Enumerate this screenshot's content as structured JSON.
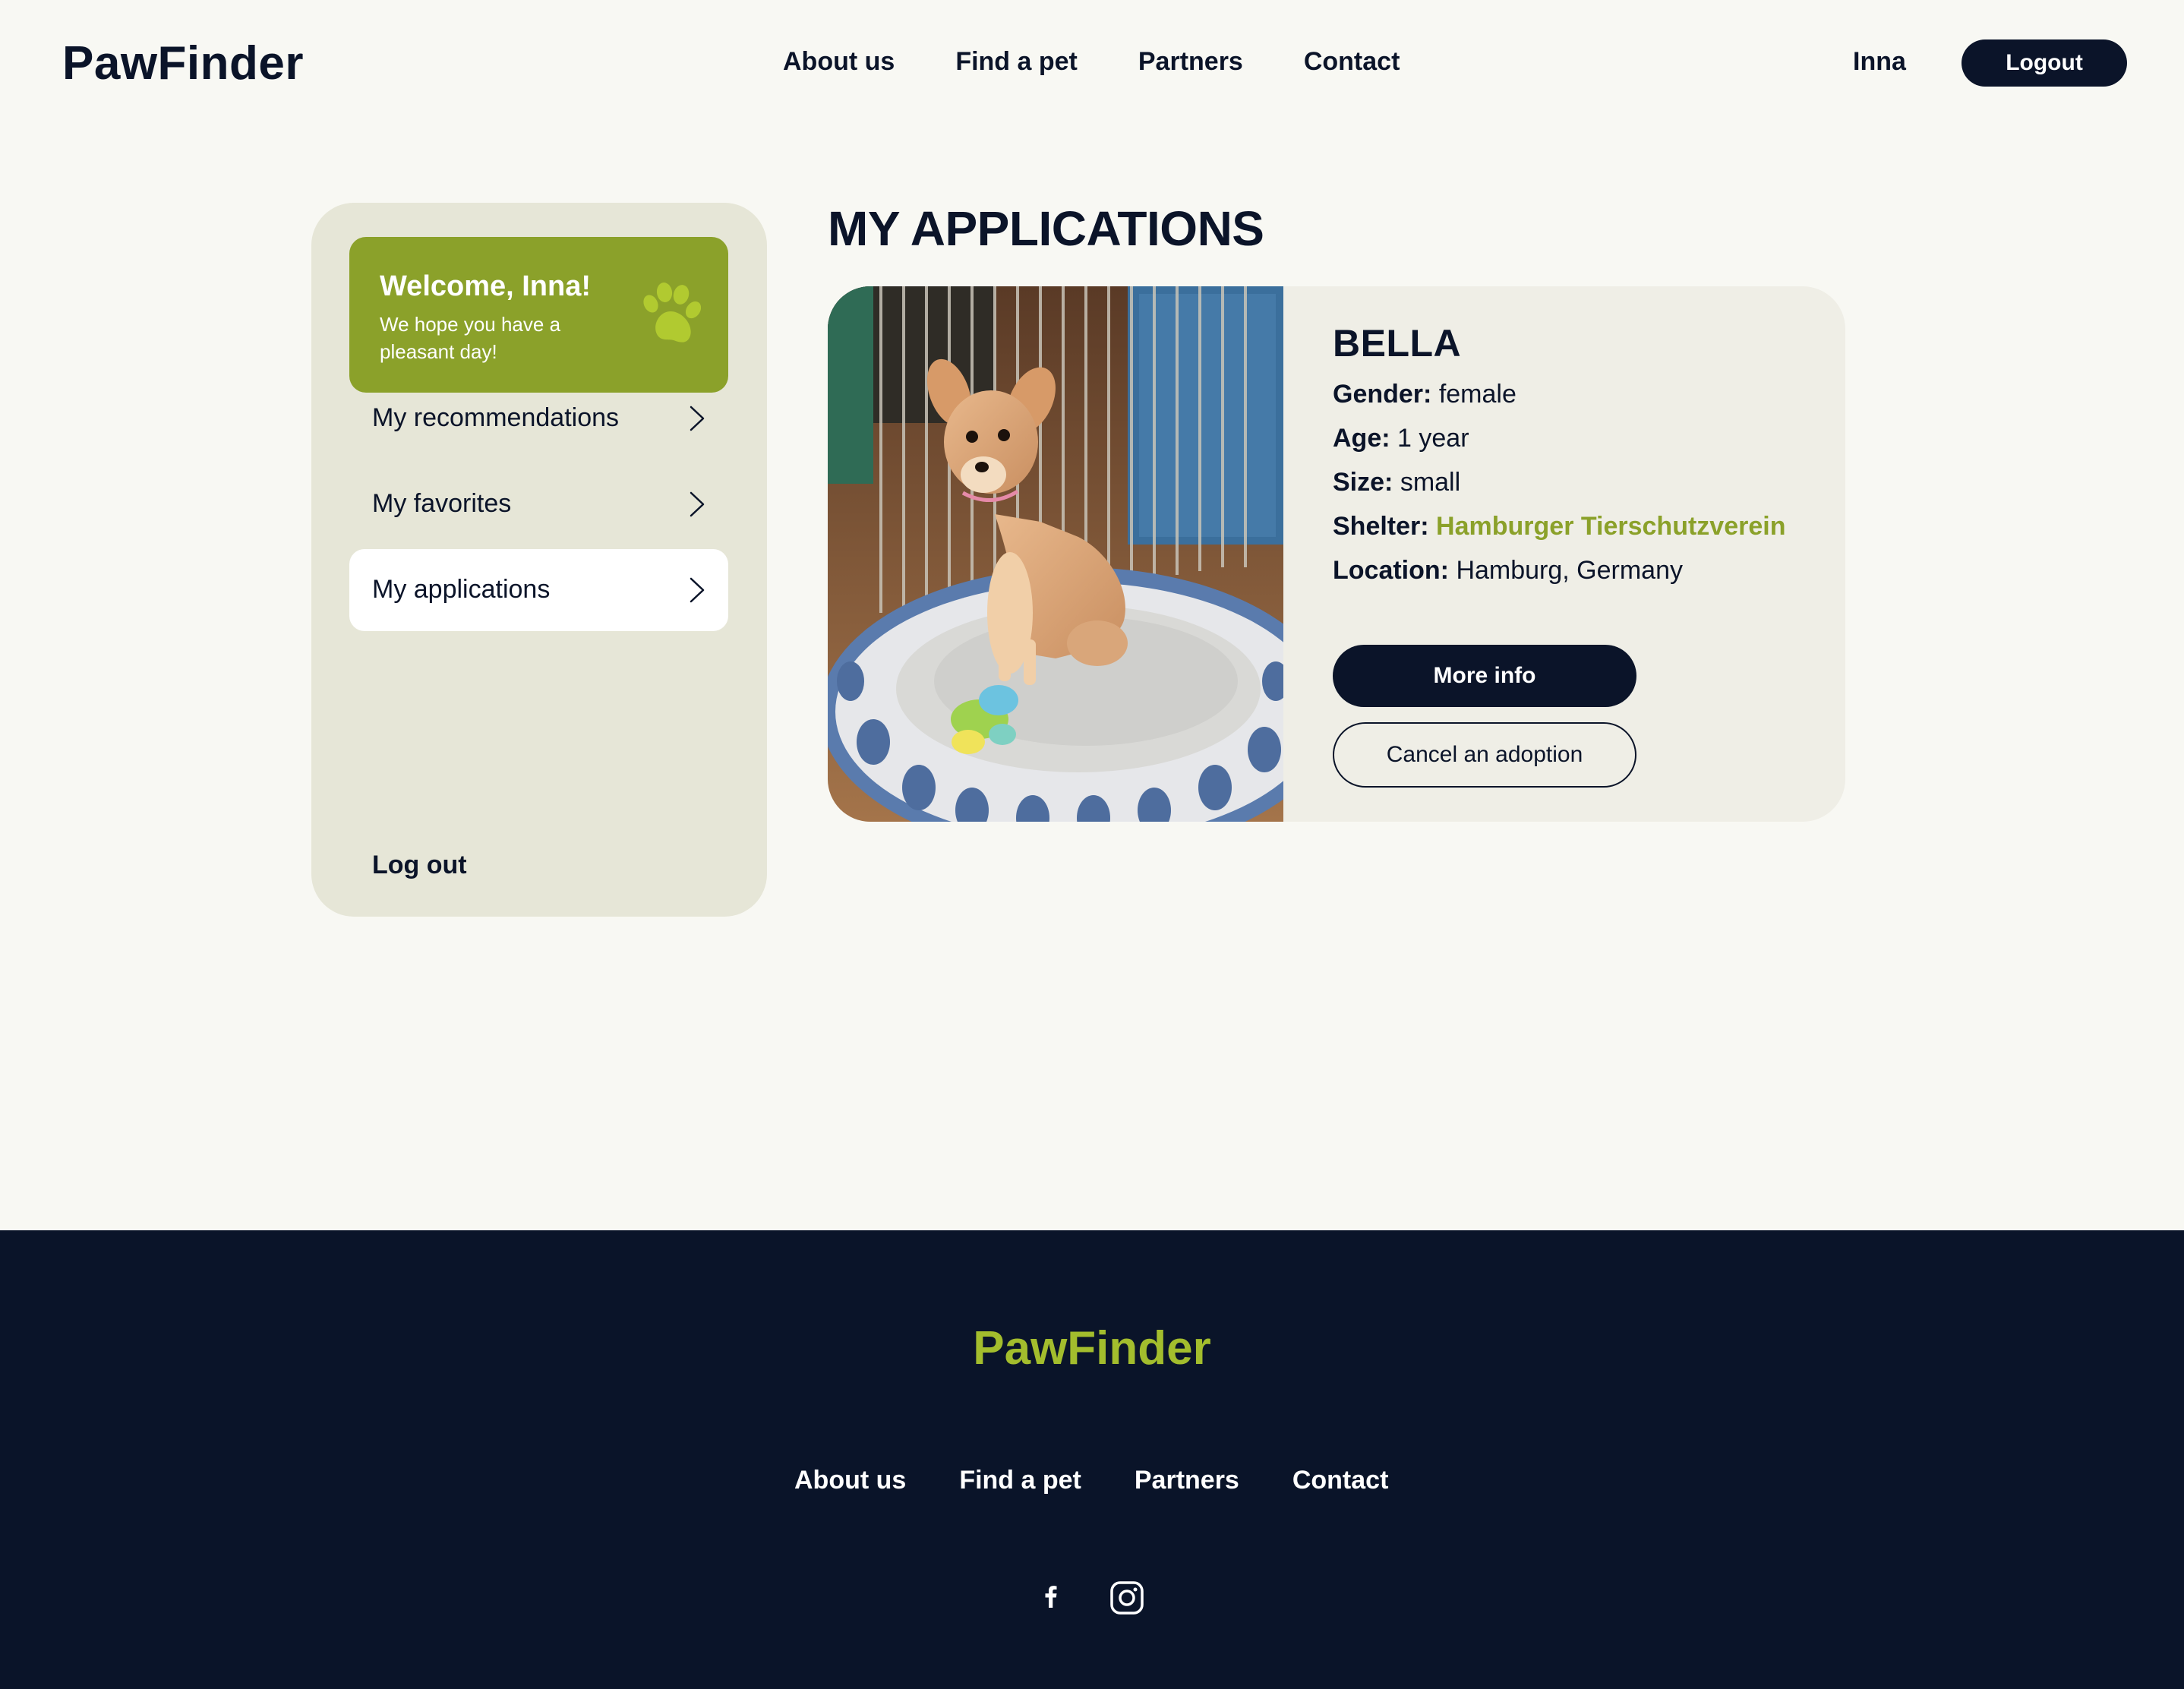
{
  "header": {
    "logo": "PawFinder",
    "nav": [
      "About us",
      "Find a pet",
      "Partners",
      "Contact"
    ],
    "user_name": "Inna",
    "logout_label": "Logout"
  },
  "sidebar": {
    "welcome_title": "Welcome, Inna!",
    "welcome_subtitle": "We hope you have a pleasant day!",
    "items": [
      {
        "label": "My recommendations",
        "active": false
      },
      {
        "label": "My favorites",
        "active": false
      },
      {
        "label": "My applications",
        "active": true
      }
    ],
    "logout_label": "Log out"
  },
  "main": {
    "title": "MY APPLICATIONS",
    "application": {
      "name": "BELLA",
      "gender_label": "Gender:",
      "gender": "female",
      "age_label": "Age:",
      "age": "1 year",
      "size_label": "Size:",
      "size": "small",
      "shelter_label": "Shelter:",
      "shelter": "Hamburger Tierschutzverein",
      "location_label": "Location:",
      "location": "Hamburg, Germany",
      "more_info_label": "More info",
      "cancel_label": "Cancel an adoption"
    }
  },
  "footer": {
    "logo": "PawFinder",
    "nav": [
      "About us",
      "Find a pet",
      "Partners",
      "Contact"
    ],
    "social": [
      "facebook-icon",
      "instagram-icon"
    ]
  },
  "colors": {
    "navy": "#0b1429",
    "accent_green": "#8ba12a",
    "footer_logo_green": "#a3bd2d",
    "page_bg": "#f8f8f3",
    "sidebar_bg": "#e6e6d7",
    "card_bg": "#efeee6"
  }
}
